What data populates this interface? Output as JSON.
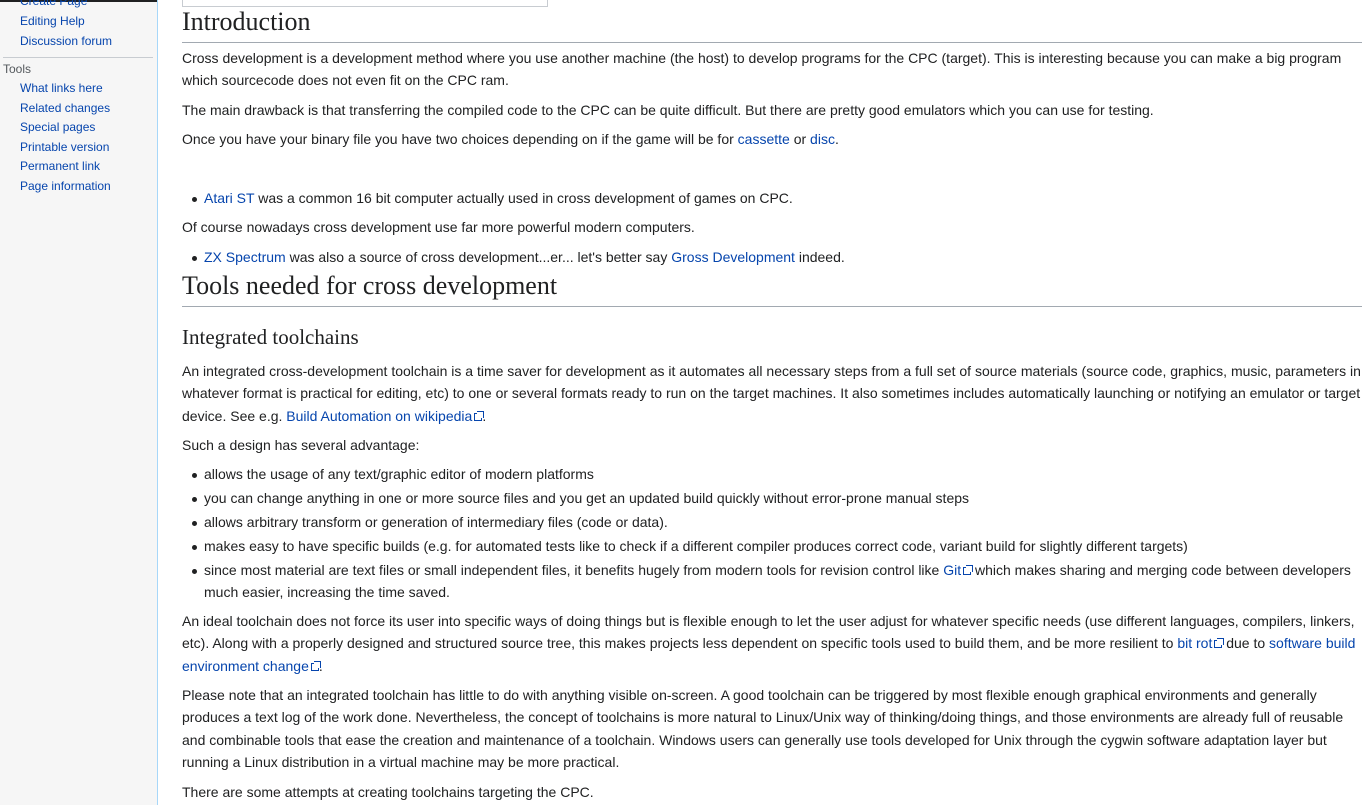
{
  "sidebar": {
    "nav_partial": [
      "Create Page",
      "Editing Help",
      "Discussion forum"
    ],
    "tools_heading": "Tools",
    "tools": [
      "What links here",
      "Related changes",
      "Special pages",
      "Printable version",
      "Permanent link",
      "Page information"
    ]
  },
  "intro": {
    "heading": "Introduction",
    "p1": "Cross development is a development method where you use another machine (the host) to develop programs for the CPC (target). This is interesting because you can make a big program which sourcecode does not even fit on the CPC ram.",
    "p2": "The main drawback is that transferring the compiled code to the CPC can be quite difficult. But there are pretty good emulators which you can use for testing.",
    "p3_before": "Once you have your binary file you have two choices depending on if the game will be for ",
    "p3_link1": "cassette",
    "p3_mid": " or ",
    "p3_link2": "disc",
    "p3_after": ".",
    "bullet1_link": "Atari ST",
    "bullet1_text": " was a common 16 bit computer actually used in cross development of games on CPC.",
    "p4": "Of course nowadays cross development use far more powerful modern computers.",
    "bullet2_link": "ZX Spectrum",
    "bullet2_text": " was also a source of cross development...er... let's better say ",
    "bullet2_link2": "Gross Development",
    "bullet2_after": " indeed."
  },
  "tools_section": {
    "heading": "Tools needed for cross development",
    "subheading": "Integrated toolchains",
    "p1_text": "An integrated cross-development toolchain is a time saver for development as it automates all necessary steps from a full set of source materials (source code, graphics, music, parameters in whatever format is practical for editing, etc) to one or several formats ready to run on the target machines. It also sometimes includes automatically launching or notifying an emulator or target device. See e.g. ",
    "p1_link": "Build Automation on wikipedia",
    "p1_after": ".",
    "p2": "Such a design has several advantage:",
    "advantages": [
      "allows the usage of any text/graphic editor of modern platforms",
      "you can change anything in one or more source files and you get an updated build quickly without error-prone manual steps",
      "allows arbitrary transform or generation of intermediary files (code or data).",
      "makes easy to have specific builds (e.g. for automated tests like to check if a different compiler produces correct code, variant build for slightly different targets)"
    ],
    "adv5_before": "since most material are text files or small independent files, it benefits hugely from modern tools for revision control like ",
    "adv5_link": "Git",
    "adv5_after": " which makes sharing and merging code between developers much easier, increasing the time saved.",
    "p3_text": "An ideal toolchain does not force its user into specific ways of doing things but is flexible enough to let the user adjust for whatever specific needs (use different languages, compilers, linkers, etc). Along with a properly designed and structured source tree, this makes projects less dependent on specific tools used to build them, and be more resilient to ",
    "p3_link1": "bit rot",
    "p3_mid": " due to ",
    "p3_link2": "software build environment change",
    "p3_after": ".",
    "p4": "Please note that an integrated toolchain has little to do with anything visible on-screen. A good toolchain can be triggered by most flexible enough graphical environments and generally produces a text log of the work done. Nevertheless, the concept of toolchains is more natural to Linux/Unix way of thinking/doing things, and those environments are already full of reusable and combinable tools that ease the creation and maintenance of a toolchain. Windows users can generally use tools developed for Unix through the cygwin software adaptation layer but running a Linux distribution in a virtual machine may be more practical.",
    "p5": "There are some attempts at creating toolchains targeting the CPC."
  },
  "colors": {
    "link": "#0645ad",
    "text": "#202122",
    "sidebar_bg": "#f6f6f6"
  },
  "icons": {
    "external_link": "external-link-icon"
  }
}
